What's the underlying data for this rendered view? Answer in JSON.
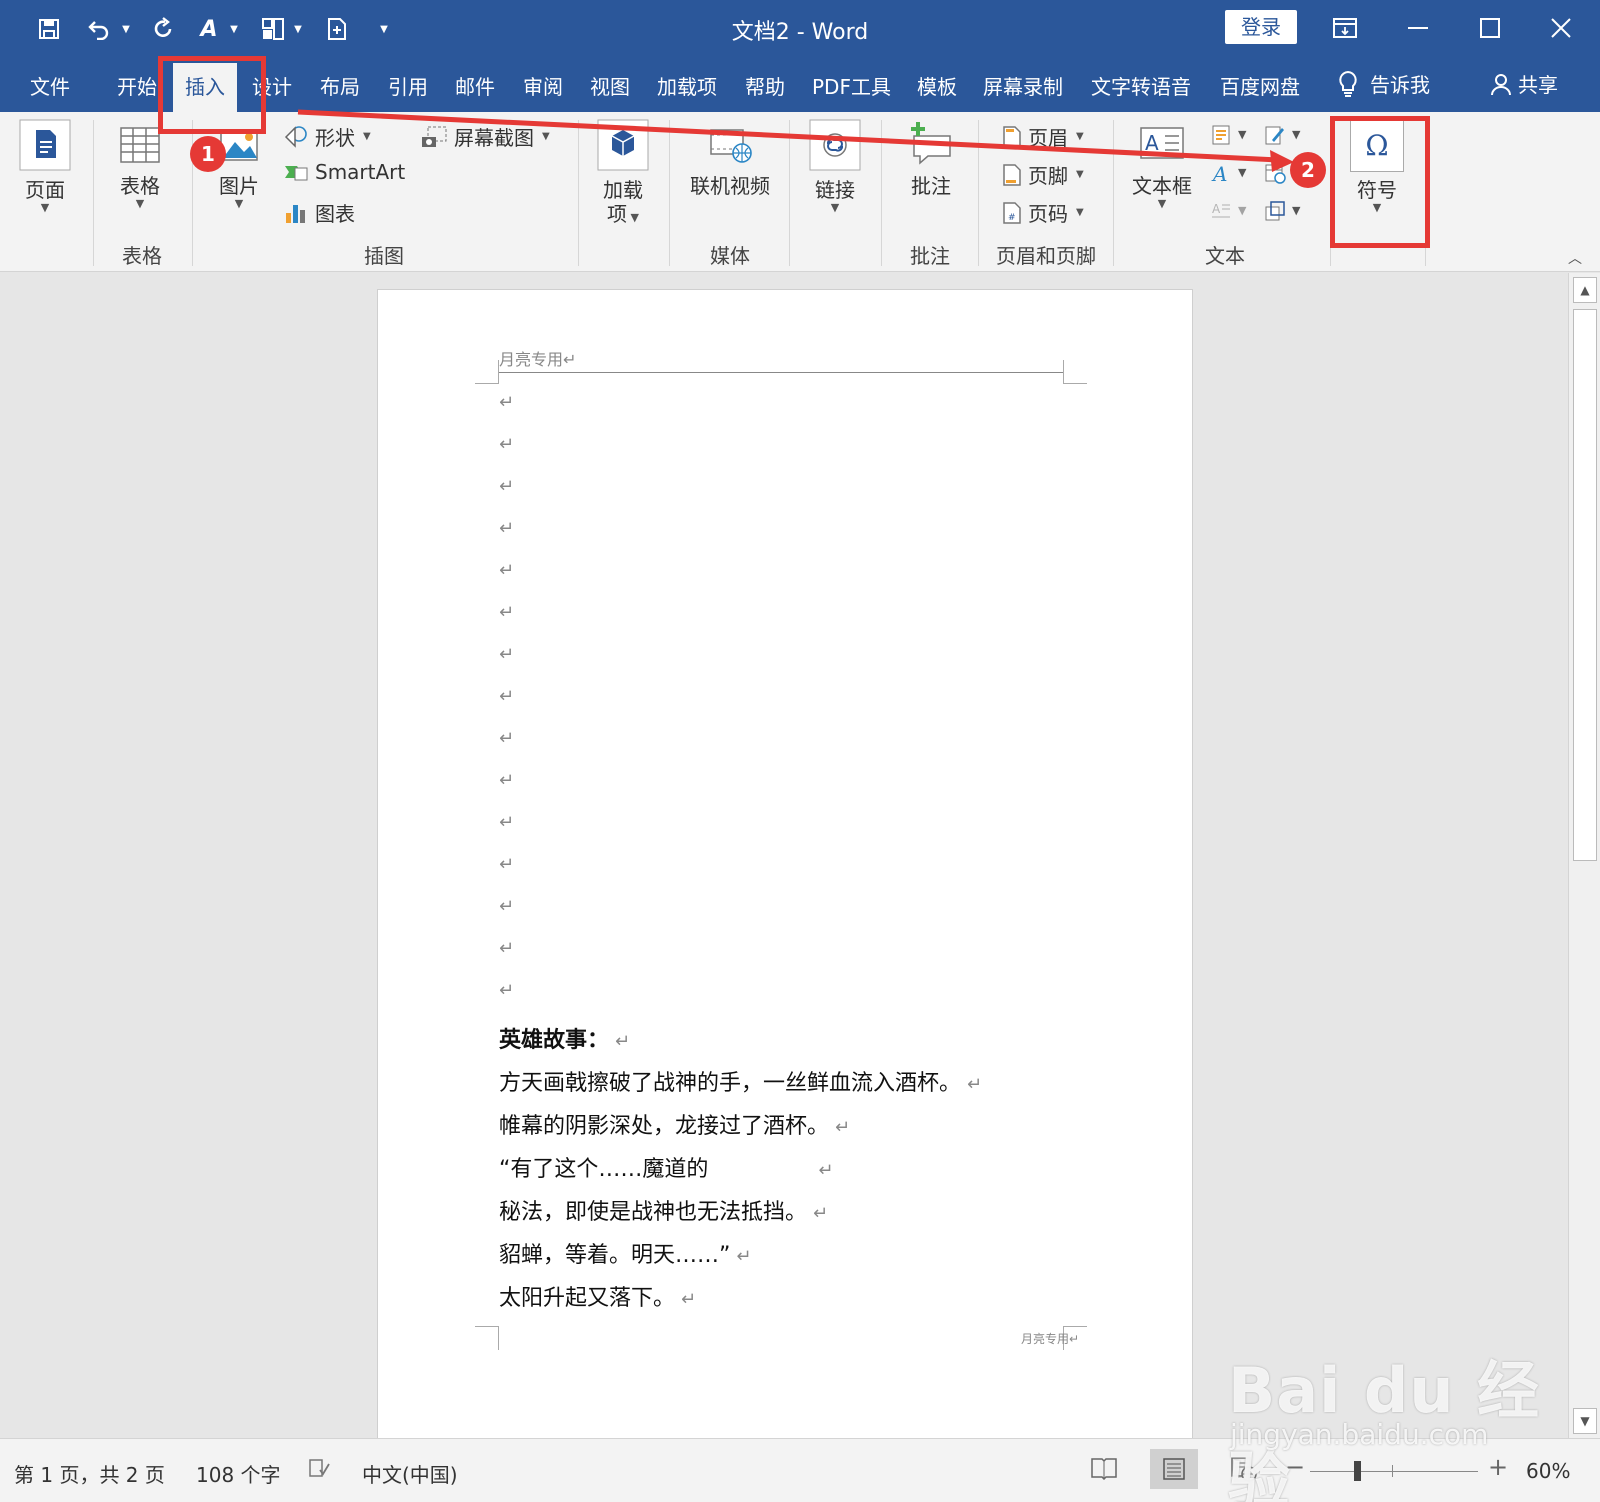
{
  "window": {
    "title": "文档2  -  Word",
    "login_label": "登录"
  },
  "quick_access": {
    "save_icon": "save-icon",
    "undo_icon": "undo-icon",
    "redo_icon": "redo-icon"
  },
  "tabs": [
    "文件",
    "开始",
    "插入",
    "设计",
    "布局",
    "引用",
    "邮件",
    "审阅",
    "视图",
    "加载项",
    "帮助",
    "PDF工具",
    "模板",
    "屏幕录制",
    "文字转语音",
    "百度网盘"
  ],
  "active_tab": "插入",
  "tell_me_label": "告诉我",
  "share_label": "共享",
  "ribbon": {
    "page_label": "页面",
    "table_label": "表格",
    "table_group": "表格",
    "picture_label": "图片",
    "shapes_label": "形状",
    "smartart_label": "SmartArt",
    "chart_label": "图表",
    "screenshot_label": "屏幕截图",
    "illustrations_group": "插图",
    "addins_label_1": "加载",
    "addins_label_2": "项",
    "online_video_label": "联机视频",
    "media_group": "媒体",
    "link_label": "链接",
    "comment_label": "批注",
    "comments_group": "批注",
    "header_label": "页眉",
    "footer_label": "页脚",
    "pagenum_label": "页码",
    "header_footer_group": "页眉和页脚",
    "textbox_label": "文本框",
    "text_group": "文本",
    "symbol_label": "符号",
    "symbol_glyph": "Ω"
  },
  "document": {
    "header_text": "月亮专用↵",
    "paragraph_mark": "↵",
    "heading": "英雄故事：",
    "lines": [
      "方天画戟擦破了战神的手，一丝鲜血流入酒杯。",
      "帷幕的阴影深处，龙接过了酒杯。",
      "“有了这个……魔道的",
      "秘法，即使是战神也无法抵挡。",
      "貂蝉，等着。明天……”",
      "太阳升起又落下。"
    ],
    "footer_text": "月亮专用↵"
  },
  "status": {
    "page_info": "第 1 页，共 2 页",
    "word_count": "108 个字",
    "language": "中文(中国)",
    "zoom": "60%",
    "zoom_minus": "−",
    "zoom_plus": "+"
  },
  "annotations": {
    "step1": "1",
    "step2": "2",
    "color": "#e53935"
  },
  "watermark": {
    "logo": "Bai du 经验",
    "url": "jingyan.baidu.com"
  },
  "colors": {
    "title_bar": "#2b579a",
    "ribbon_bg": "#f3f3f3",
    "workspace_bg": "#e6e6e6"
  }
}
